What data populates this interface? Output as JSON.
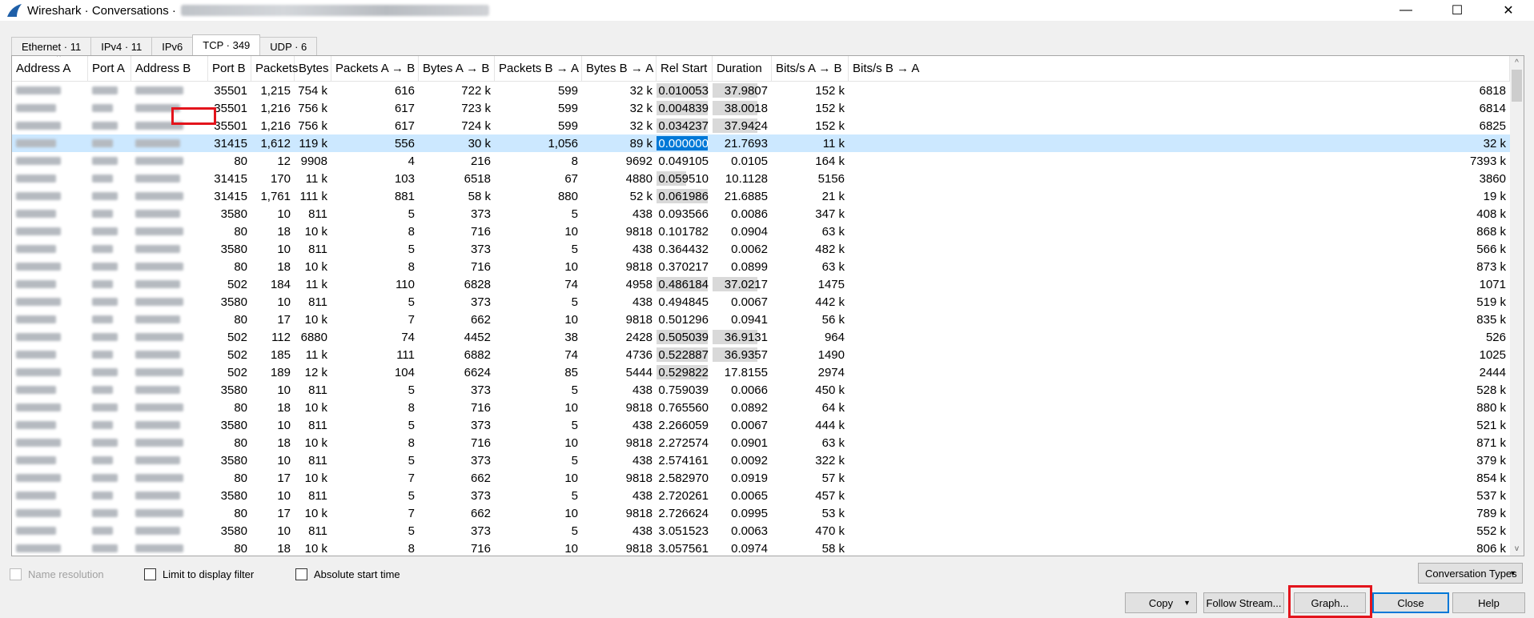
{
  "window": {
    "title": "Wireshark · Conversations ·",
    "controls": {
      "minimize": "—",
      "maximize": "☐",
      "close": "✕"
    }
  },
  "tabs": [
    {
      "label": "Ethernet · 11",
      "active": false
    },
    {
      "label": "IPv4 · 11",
      "active": false
    },
    {
      "label": "IPv6",
      "active": false
    },
    {
      "label": "TCP · 349",
      "active": true
    },
    {
      "label": "UDP · 6",
      "active": false
    }
  ],
  "columns": [
    "Address A",
    "Port A",
    "Address B",
    "Port B",
    "Packets",
    "Bytes",
    "Packets A → B",
    "Bytes A → B",
    "Packets B → A",
    "Bytes B → A",
    "Rel Start",
    "Duration",
    "Bits/s A → B",
    "Bits/s B → A"
  ],
  "rows": [
    {
      "port_b": "35501",
      "packets": "1,215",
      "bytes": "754 k",
      "pkts_ab": "616",
      "bytes_ab": "722 k",
      "pkts_ba": "599",
      "bytes_ba": "32 k",
      "rel_start": "0.010053",
      "rel_frac": 1.0,
      "duration": "37.9807",
      "dur_frac": 1.0,
      "bps_ab": "152 k",
      "bps_ba": "6818"
    },
    {
      "port_b": "35501",
      "packets": "1,216",
      "bytes": "756 k",
      "pkts_ab": "617",
      "bytes_ab": "723 k",
      "pkts_ba": "599",
      "bytes_ba": "32 k",
      "rel_start": "0.004839",
      "rel_frac": 1.0,
      "duration": "38.0018",
      "dur_frac": 1.0,
      "bps_ab": "152 k",
      "bps_ba": "6814"
    },
    {
      "port_b": "35501",
      "packets": "1,216",
      "bytes": "756 k",
      "pkts_ab": "617",
      "bytes_ab": "724 k",
      "pkts_ba": "599",
      "bytes_ba": "32 k",
      "rel_start": "0.034237",
      "rel_frac": 1.0,
      "duration": "37.9424",
      "dur_frac": 1.0,
      "bps_ab": "152 k",
      "bps_ba": "6825"
    },
    {
      "port_b": "31415",
      "packets": "1,612",
      "bytes": "119 k",
      "pkts_ab": "556",
      "bytes_ab": "30 k",
      "pkts_ba": "1,056",
      "bytes_ba": "89 k",
      "rel_start": "0.000000",
      "rel_frac": 1.0,
      "duration": "21.7693",
      "dur_frac": 0.0,
      "bps_ab": "11 k",
      "bps_ba": "32 k",
      "selected": true
    },
    {
      "port_b": "80",
      "packets": "12",
      "bytes": "9908",
      "pkts_ab": "4",
      "bytes_ab": "216",
      "pkts_ba": "8",
      "bytes_ba": "9692",
      "rel_start": "0.049105",
      "rel_frac": 0.0,
      "duration": "0.0105",
      "dur_frac": 0.0,
      "bps_ab": "164 k",
      "bps_ba": "7393 k"
    },
    {
      "port_b": "31415",
      "packets": "170",
      "bytes": "11 k",
      "pkts_ab": "103",
      "bytes_ab": "6518",
      "pkts_ba": "67",
      "bytes_ba": "4880",
      "rel_start": "0.059510",
      "rel_frac": 0.58,
      "duration": "10.1128",
      "dur_frac": 0.0,
      "bps_ab": "5156",
      "bps_ba": "3860"
    },
    {
      "port_b": "31415",
      "packets": "1,761",
      "bytes": "111 k",
      "pkts_ab": "881",
      "bytes_ab": "58 k",
      "pkts_ba": "880",
      "bytes_ba": "52 k",
      "rel_start": "0.061986",
      "rel_frac": 1.0,
      "duration": "21.6885",
      "dur_frac": 0.0,
      "bps_ab": "21 k",
      "bps_ba": "19 k"
    },
    {
      "port_b": "3580",
      "packets": "10",
      "bytes": "811",
      "pkts_ab": "5",
      "bytes_ab": "373",
      "pkts_ba": "5",
      "bytes_ba": "438",
      "rel_start": "0.093566",
      "rel_frac": 0.0,
      "duration": "0.0086",
      "dur_frac": 0.0,
      "bps_ab": "347 k",
      "bps_ba": "408 k"
    },
    {
      "port_b": "80",
      "packets": "18",
      "bytes": "10 k",
      "pkts_ab": "8",
      "bytes_ab": "716",
      "pkts_ba": "10",
      "bytes_ba": "9818",
      "rel_start": "0.101782",
      "rel_frac": 0.0,
      "duration": "0.0904",
      "dur_frac": 0.0,
      "bps_ab": "63 k",
      "bps_ba": "868 k"
    },
    {
      "port_b": "3580",
      "packets": "10",
      "bytes": "811",
      "pkts_ab": "5",
      "bytes_ab": "373",
      "pkts_ba": "5",
      "bytes_ba": "438",
      "rel_start": "0.364432",
      "rel_frac": 0.0,
      "duration": "0.0062",
      "dur_frac": 0.0,
      "bps_ab": "482 k",
      "bps_ba": "566 k"
    },
    {
      "port_b": "80",
      "packets": "18",
      "bytes": "10 k",
      "pkts_ab": "8",
      "bytes_ab": "716",
      "pkts_ba": "10",
      "bytes_ba": "9818",
      "rel_start": "0.370217",
      "rel_frac": 0.0,
      "duration": "0.0899",
      "dur_frac": 0.0,
      "bps_ab": "63 k",
      "bps_ba": "873 k"
    },
    {
      "port_b": "502",
      "packets": "184",
      "bytes": "11 k",
      "pkts_ab": "110",
      "bytes_ab": "6828",
      "pkts_ba": "74",
      "bytes_ba": "4958",
      "rel_start": "0.486184",
      "rel_frac": 1.0,
      "duration": "37.0217",
      "dur_frac": 1.0,
      "bps_ab": "1475",
      "bps_ba": "1071"
    },
    {
      "port_b": "3580",
      "packets": "10",
      "bytes": "811",
      "pkts_ab": "5",
      "bytes_ab": "373",
      "pkts_ba": "5",
      "bytes_ba": "438",
      "rel_start": "0.494845",
      "rel_frac": 0.0,
      "duration": "0.0067",
      "dur_frac": 0.0,
      "bps_ab": "442 k",
      "bps_ba": "519 k"
    },
    {
      "port_b": "80",
      "packets": "17",
      "bytes": "10 k",
      "pkts_ab": "7",
      "bytes_ab": "662",
      "pkts_ba": "10",
      "bytes_ba": "9818",
      "rel_start": "0.501296",
      "rel_frac": 0.0,
      "duration": "0.0941",
      "dur_frac": 0.0,
      "bps_ab": "56 k",
      "bps_ba": "835 k"
    },
    {
      "port_b": "502",
      "packets": "112",
      "bytes": "6880",
      "pkts_ab": "74",
      "bytes_ab": "4452",
      "pkts_ba": "38",
      "bytes_ba": "2428",
      "rel_start": "0.505039",
      "rel_frac": 1.0,
      "duration": "36.9131",
      "dur_frac": 1.0,
      "bps_ab": "964",
      "bps_ba": "526"
    },
    {
      "port_b": "502",
      "packets": "185",
      "bytes": "11 k",
      "pkts_ab": "111",
      "bytes_ab": "6882",
      "pkts_ba": "74",
      "bytes_ba": "4736",
      "rel_start": "0.522887",
      "rel_frac": 1.0,
      "duration": "36.9357",
      "dur_frac": 1.0,
      "bps_ab": "1490",
      "bps_ba": "1025"
    },
    {
      "port_b": "502",
      "packets": "189",
      "bytes": "12 k",
      "pkts_ab": "104",
      "bytes_ab": "6624",
      "pkts_ba": "85",
      "bytes_ba": "5444",
      "rel_start": "0.529822",
      "rel_frac": 1.0,
      "duration": "17.8155",
      "dur_frac": 0.0,
      "bps_ab": "2974",
      "bps_ba": "2444"
    },
    {
      "port_b": "3580",
      "packets": "10",
      "bytes": "811",
      "pkts_ab": "5",
      "bytes_ab": "373",
      "pkts_ba": "5",
      "bytes_ba": "438",
      "rel_start": "0.759039",
      "rel_frac": 0.0,
      "duration": "0.0066",
      "dur_frac": 0.0,
      "bps_ab": "450 k",
      "bps_ba": "528 k"
    },
    {
      "port_b": "80",
      "packets": "18",
      "bytes": "10 k",
      "pkts_ab": "8",
      "bytes_ab": "716",
      "pkts_ba": "10",
      "bytes_ba": "9818",
      "rel_start": "0.765560",
      "rel_frac": 0.0,
      "duration": "0.0892",
      "dur_frac": 0.0,
      "bps_ab": "64 k",
      "bps_ba": "880 k"
    },
    {
      "port_b": "3580",
      "packets": "10",
      "bytes": "811",
      "pkts_ab": "5",
      "bytes_ab": "373",
      "pkts_ba": "5",
      "bytes_ba": "438",
      "rel_start": "2.266059",
      "rel_frac": 0.0,
      "duration": "0.0067",
      "dur_frac": 0.0,
      "bps_ab": "444 k",
      "bps_ba": "521 k"
    },
    {
      "port_b": "80",
      "packets": "18",
      "bytes": "10 k",
      "pkts_ab": "8",
      "bytes_ab": "716",
      "pkts_ba": "10",
      "bytes_ba": "9818",
      "rel_start": "2.272574",
      "rel_frac": 0.0,
      "duration": "0.0901",
      "dur_frac": 0.0,
      "bps_ab": "63 k",
      "bps_ba": "871 k"
    },
    {
      "port_b": "3580",
      "packets": "10",
      "bytes": "811",
      "pkts_ab": "5",
      "bytes_ab": "373",
      "pkts_ba": "5",
      "bytes_ba": "438",
      "rel_start": "2.574161",
      "rel_frac": 0.0,
      "duration": "0.0092",
      "dur_frac": 0.0,
      "bps_ab": "322 k",
      "bps_ba": "379 k"
    },
    {
      "port_b": "80",
      "packets": "17",
      "bytes": "10 k",
      "pkts_ab": "7",
      "bytes_ab": "662",
      "pkts_ba": "10",
      "bytes_ba": "9818",
      "rel_start": "2.582970",
      "rel_frac": 0.0,
      "duration": "0.0919",
      "dur_frac": 0.0,
      "bps_ab": "57 k",
      "bps_ba": "854 k"
    },
    {
      "port_b": "3580",
      "packets": "10",
      "bytes": "811",
      "pkts_ab": "5",
      "bytes_ab": "373",
      "pkts_ba": "5",
      "bytes_ba": "438",
      "rel_start": "2.720261",
      "rel_frac": 0.0,
      "duration": "0.0065",
      "dur_frac": 0.0,
      "bps_ab": "457 k",
      "bps_ba": "537 k"
    },
    {
      "port_b": "80",
      "packets": "17",
      "bytes": "10 k",
      "pkts_ab": "7",
      "bytes_ab": "662",
      "pkts_ba": "10",
      "bytes_ba": "9818",
      "rel_start": "2.726624",
      "rel_frac": 0.0,
      "duration": "0.0995",
      "dur_frac": 0.0,
      "bps_ab": "53 k",
      "bps_ba": "789 k"
    },
    {
      "port_b": "3580",
      "packets": "10",
      "bytes": "811",
      "pkts_ab": "5",
      "bytes_ab": "373",
      "pkts_ba": "5",
      "bytes_ba": "438",
      "rel_start": "3.051523",
      "rel_frac": 0.0,
      "duration": "0.0063",
      "dur_frac": 0.0,
      "bps_ab": "470 k",
      "bps_ba": "552 k"
    },
    {
      "port_b": "80",
      "packets": "18",
      "bytes": "10 k",
      "pkts_ab": "8",
      "bytes_ab": "716",
      "pkts_ba": "10",
      "bytes_ba": "9818",
      "rel_start": "3.057561",
      "rel_frac": 0.0,
      "duration": "0.0974",
      "dur_frac": 0.0,
      "bps_ab": "58 k",
      "bps_ba": "806 k"
    }
  ],
  "options": {
    "name_resolution": "Name resolution",
    "limit_filter": "Limit to display filter",
    "absolute_start": "Absolute start time"
  },
  "buttons": {
    "conversation_types": "Conversation Types",
    "copy": "Copy",
    "follow_stream": "Follow Stream...",
    "graph": "Graph...",
    "close": "Close",
    "help": "Help"
  },
  "colors": {
    "selection": "#cce8ff",
    "highlight": "#0078d7",
    "bar": "#d9d9d9",
    "annotation": "#e3141c"
  }
}
